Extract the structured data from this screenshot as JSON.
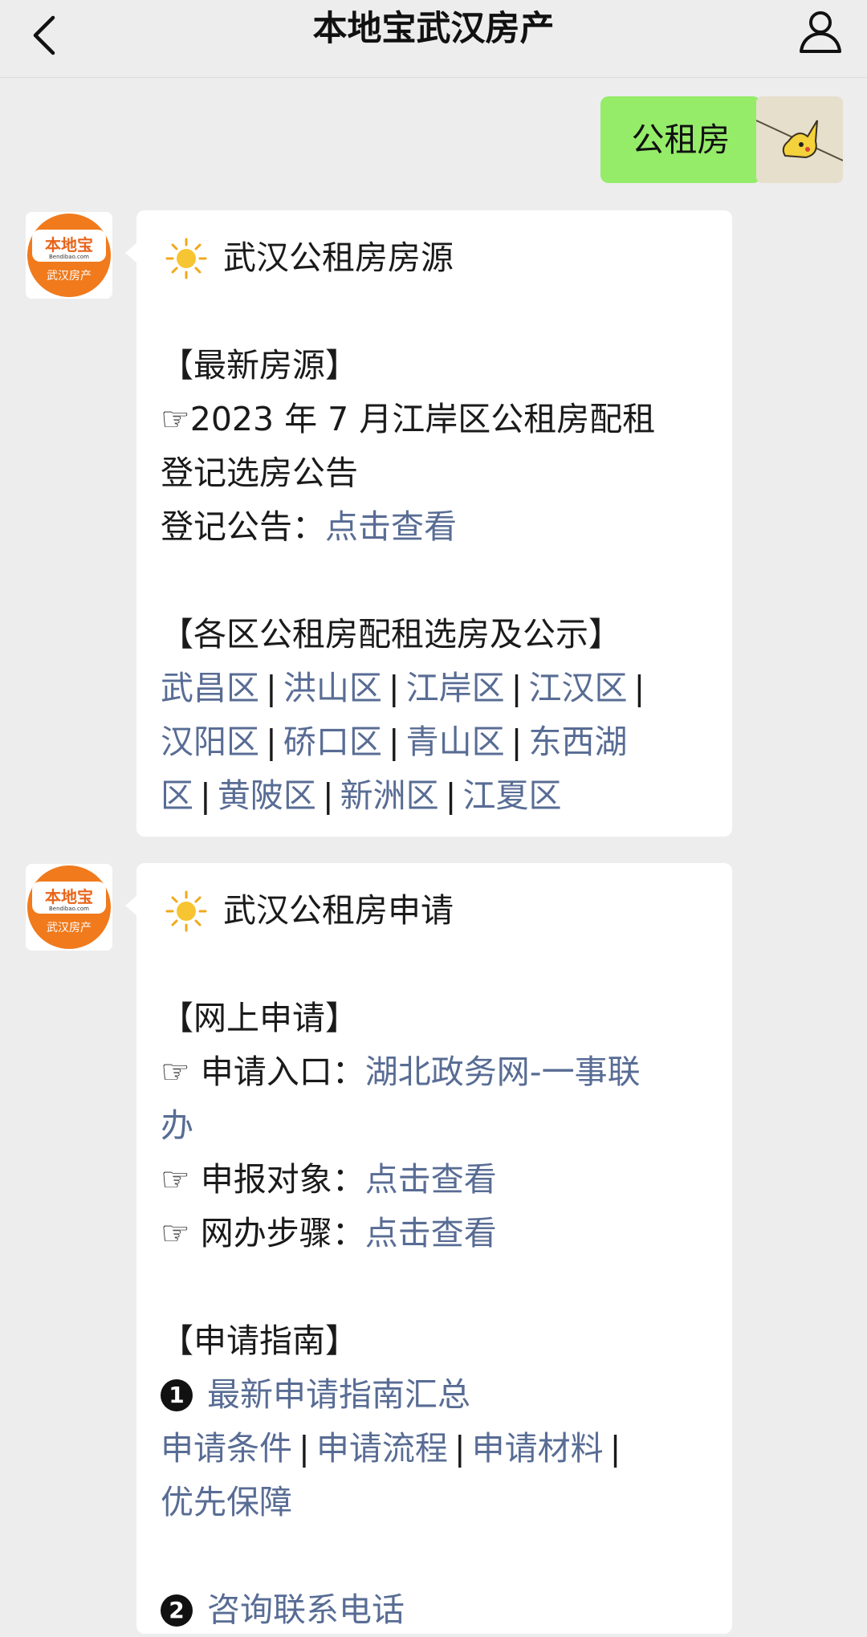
{
  "header": {
    "title": "本地宝武汉房产"
  },
  "sent_message": {
    "text": "公租房"
  },
  "bot": {
    "logo_top": "本地宝",
    "logo_mid": "Bendibao.com",
    "logo_bottom": "武汉房产"
  },
  "card1": {
    "heading": "武汉公租房房源",
    "section1_title": "【最新房源】",
    "item1_text": "☞2023 年 7 月江岸区公租房配租",
    "item1_text_cont": "登记选房公告",
    "notice_label": "登记公告：",
    "notice_link": "点击查看",
    "section2_title": "【各区公租房配租选房及公示】",
    "districts": [
      "武昌区",
      "洪山区",
      "江岸区",
      "江汉区",
      "汉阳区",
      "硚口区",
      "青山区",
      "东西湖",
      "区",
      "黄陂区",
      "新洲区",
      "江夏区"
    ]
  },
  "card2": {
    "heading": "武汉公租房申请",
    "section1_title": "【网上申请】",
    "entry_label": "☞ 申请入口：",
    "entry_link": "湖北政务网-一事联",
    "entry_link_cont": "办",
    "target_label": "☞ 申报对象：",
    "target_link": "点击查看",
    "steps_label": "☞ 网办步骤：",
    "steps_link": "点击查看",
    "section2_title": "【申请指南】",
    "guide_num1": "1",
    "guide_link1": "最新申请指南汇总",
    "guide_links": [
      "申请条件",
      "申请流程",
      "申请材料",
      "优先保障"
    ],
    "guide_num2": "2",
    "guide_link2": "咨询联系电话"
  }
}
